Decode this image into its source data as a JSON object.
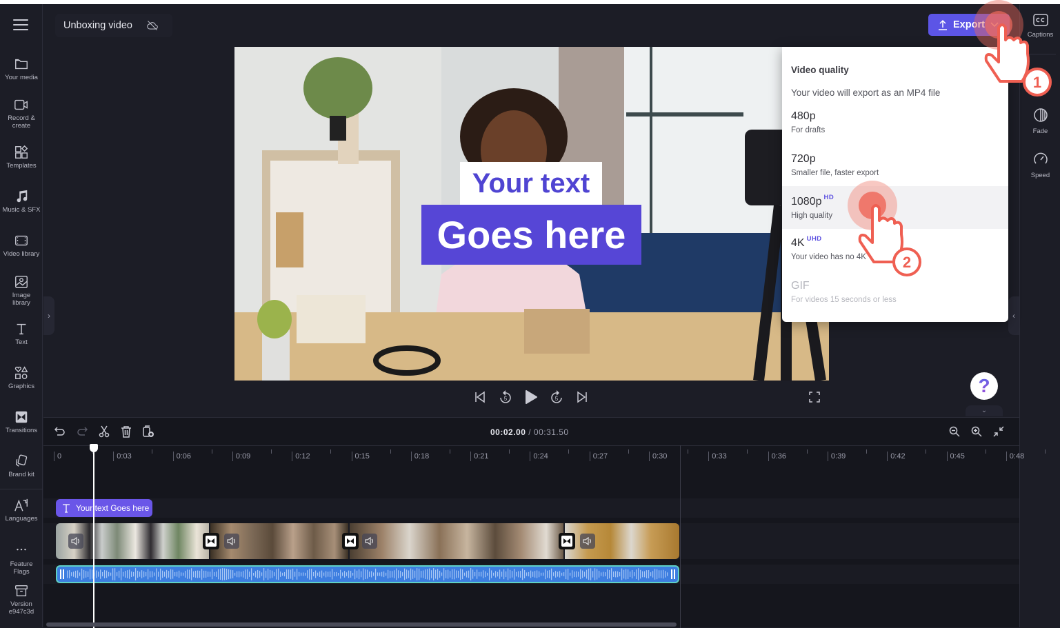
{
  "header": {
    "project_title": "Unboxing video",
    "cloud_status_icon": "cloud-off-icon",
    "export_label": "Export"
  },
  "left_sidebar": {
    "items": [
      {
        "label": "Your media",
        "icon": "folder-icon"
      },
      {
        "label": "Record & create",
        "icon": "camera-icon"
      },
      {
        "label": "Templates",
        "icon": "templates-icon"
      },
      {
        "label": "Music & SFX",
        "icon": "music-note-icon"
      },
      {
        "label": "Video library",
        "icon": "film-icon"
      },
      {
        "label": "Image library",
        "icon": "image-icon"
      },
      {
        "label": "Text",
        "icon": "text-icon"
      },
      {
        "label": "Graphics",
        "icon": "shapes-icon"
      },
      {
        "label": "Transitions",
        "icon": "transition-icon"
      },
      {
        "label": "Brand kit",
        "icon": "brand-kit-icon"
      },
      {
        "label": "Languages",
        "icon": "languages-icon"
      },
      {
        "label": "Feature Flags",
        "icon": "more-icon"
      },
      {
        "label": "Version e947c3d",
        "icon": "archive-icon"
      }
    ]
  },
  "right_sidebar": {
    "items": [
      {
        "label": "Captions",
        "icon": "cc-icon"
      },
      {
        "label": "Fade",
        "icon": "fade-icon"
      },
      {
        "label": "Speed",
        "icon": "speedometer-icon"
      }
    ]
  },
  "preview": {
    "caption_line1": "Your text",
    "caption_line2": "Goes here"
  },
  "export_menu": {
    "title": "Video quality",
    "subtitle": "Your video will export as an MP4 file",
    "options": [
      {
        "quality": "480p",
        "badge": "",
        "description": "For drafts",
        "state": "enabled"
      },
      {
        "quality": "720p",
        "badge": "",
        "description": "Smaller file, faster export",
        "state": "enabled"
      },
      {
        "quality": "1080p",
        "badge": "HD",
        "description": "High quality",
        "state": "hovered"
      },
      {
        "quality": "4K",
        "badge": "UHD",
        "description": "Your video has no 4K",
        "state": "enabled"
      },
      {
        "quality": "GIF",
        "badge": "",
        "description": "For videos 15 seconds or less",
        "state": "disabled"
      }
    ]
  },
  "tutorial": {
    "step1": "1",
    "step2": "2"
  },
  "playback": {
    "current_time": "00:02.00",
    "separator": " / ",
    "total_time": "00:31.50",
    "skip_back_seconds": "5",
    "skip_forward_seconds": "5"
  },
  "help": {
    "label": "?"
  },
  "timeline": {
    "ruler_labels": [
      "0",
      "0:03",
      "0:06",
      "0:09",
      "0:12",
      "0:15",
      "0:18",
      "0:21",
      "0:24",
      "0:27",
      "0:30",
      "0:33",
      "0:36",
      "0:39",
      "0:42",
      "0:45",
      "0:48"
    ],
    "text_clip_label": "Your text Goes here",
    "playhead_seconds": 2.0,
    "duration_seconds": 31.5
  },
  "colors": {
    "accent": "#5c55e6",
    "caption_purple": "#5646d6",
    "audio_blue": "#3d7ee0",
    "audio_border": "#5fd1c6",
    "pointer_red": "#ef5f52"
  }
}
